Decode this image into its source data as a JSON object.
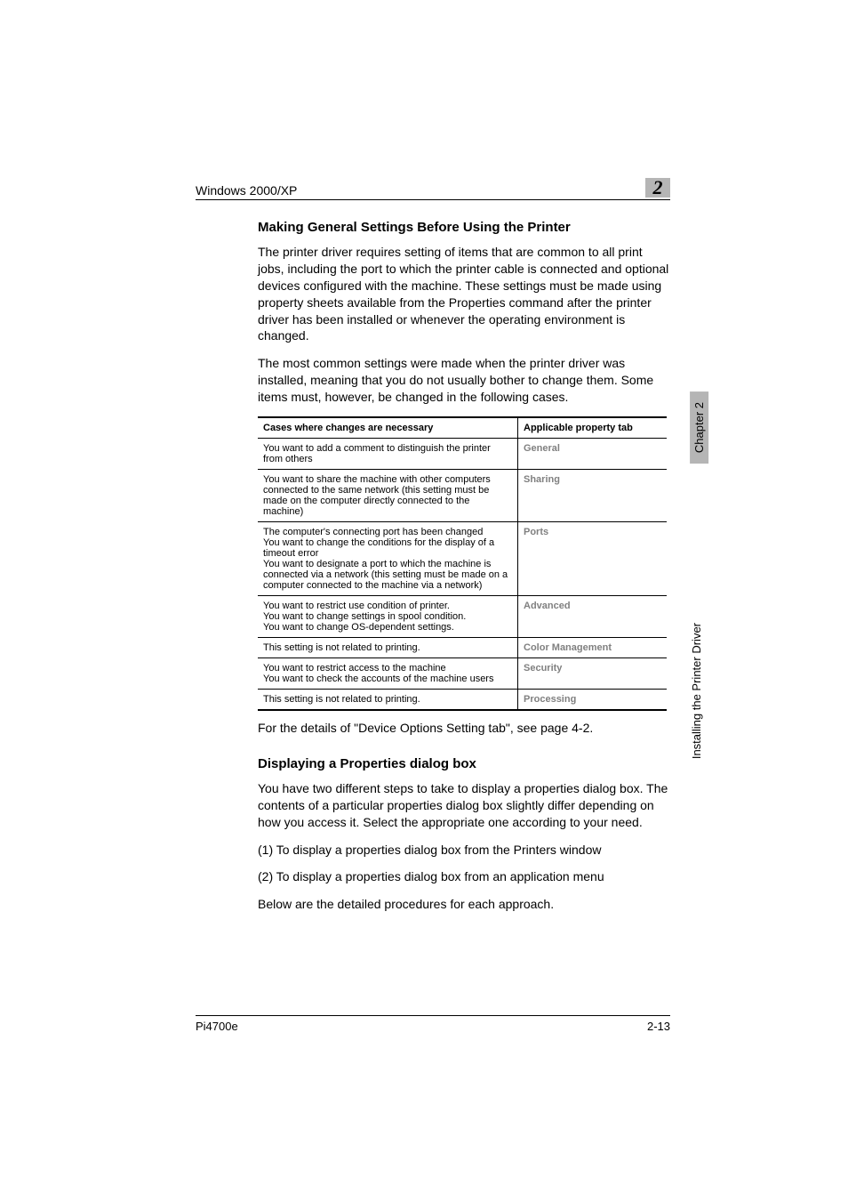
{
  "header": {
    "left": "Windows 2000/XP",
    "chapter_num": "2"
  },
  "side": {
    "chapter": "Chapter 2",
    "driver": "Installing the Printer Driver"
  },
  "section1": {
    "title": "Making General Settings Before Using the Printer",
    "p1": "The printer driver requires setting of items that are common to all print jobs, including the port to which the printer cable is connected and optional devices configured with the machine. These settings must be made using property sheets available from the Properties command after the printer driver has been installed or whenever the operating environment is changed.",
    "p2": "The most common settings were made when the printer driver was installed, meaning that you do not usually bother to change them. Some items must, however, be changed in the following cases."
  },
  "table": {
    "head_left": "Cases where changes are necessary",
    "head_right": "Applicable property tab",
    "rows": [
      {
        "left": "You want to add a comment to distinguish the printer from others",
        "right": "General"
      },
      {
        "left": "You want to share the machine with other computers connected to the same network (this setting must be made on the computer directly connected to the machine)",
        "right": "Sharing"
      },
      {
        "left": "The computer's connecting port has been changed\nYou want to change the conditions for the display of a timeout error\nYou want to designate a port to which the machine is connected via a network (this setting must be made on a computer connected to the machine via a network)",
        "right": "Ports"
      },
      {
        "left": "You want to restrict use condition of printer.\nYou want to change settings in spool condition.\nYou want to change OS-dependent settings.",
        "right": "Advanced"
      },
      {
        "left": "This setting is not related to printing.",
        "right": "Color Management"
      },
      {
        "left": "You want to restrict access to the machine\nYou want to check the accounts of the machine users",
        "right": "Security"
      },
      {
        "left": "This setting is not related to printing.",
        "right": "Processing"
      }
    ]
  },
  "after_table": "For the details of \"Device Options Setting tab\", see page 4-2.",
  "section2": {
    "title": "Displaying a Properties dialog box",
    "p1": "You have two different steps to take to display a properties dialog box. The contents of a particular properties dialog box slightly differ depending on how you access it. Select the appropriate one according to your need.",
    "l1": "(1) To display a properties dialog box from the Printers window",
    "l2": "(2) To display a properties dialog box from an application menu",
    "p2": "Below are the detailed procedures for each approach."
  },
  "footer": {
    "left": "Pi4700e",
    "right": "2-13"
  }
}
